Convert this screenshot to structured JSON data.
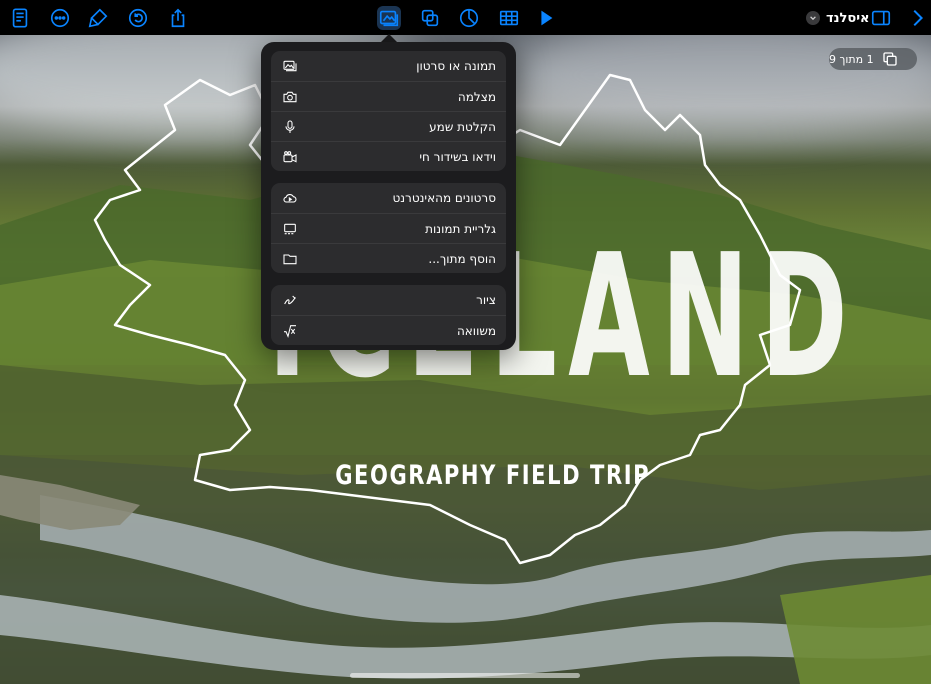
{
  "toolbar": {
    "document_title": "איסלנד",
    "left_icons": [
      "document-icon",
      "more-icon",
      "format-brush-icon",
      "undo-icon",
      "share-icon"
    ],
    "center_icons": [
      "media-icon",
      "shapes-icon",
      "chart-icon",
      "table-icon",
      "play-icon"
    ],
    "right_icons": [
      "sidebar-icon",
      "chevron-right-icon"
    ],
    "accent_color": "#0a84ff"
  },
  "slide_counter": {
    "text": "1 מתוך 9"
  },
  "slide": {
    "title": "ICELAND",
    "subtitle": "GEOGRAPHY FIELD TRIP"
  },
  "insert_menu": {
    "groups": [
      {
        "items": [
          {
            "label": "תמונה או סרטון",
            "icon": "photo-icon"
          },
          {
            "label": "מצלמה",
            "icon": "camera-icon"
          },
          {
            "label": "הקלטת שמע",
            "icon": "microphone-icon"
          },
          {
            "label": "וידאו בשידור חי",
            "icon": "live-video-icon"
          }
        ]
      },
      {
        "items": [
          {
            "label": "סרטונים מהאינטרנט",
            "icon": "cloud-video-icon"
          },
          {
            "label": "גלריית תמונות",
            "icon": "image-gallery-icon"
          },
          {
            "label": "הוסף מתוך...",
            "icon": "folder-icon"
          }
        ]
      },
      {
        "items": [
          {
            "label": "ציור",
            "icon": "drawing-icon"
          },
          {
            "label": "משוואה",
            "icon": "equation-icon"
          }
        ]
      }
    ]
  }
}
